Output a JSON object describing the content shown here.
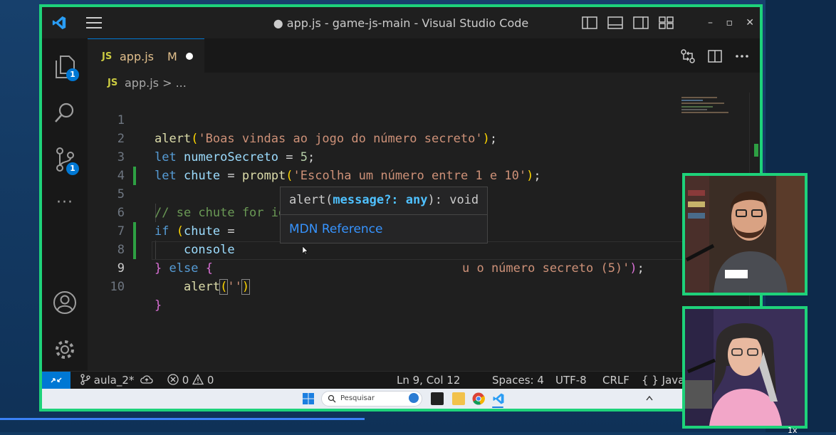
{
  "window": {
    "title": "● app.js - game-js-main - Visual Studio Code",
    "minimize": "–",
    "restore": "▫",
    "close": "✕"
  },
  "activity": {
    "explorer_badge": "1",
    "scm_badge": "1",
    "more": "···"
  },
  "tab": {
    "icon": "JS",
    "filename": "app.js",
    "status": "M"
  },
  "breadcrumb": {
    "icon": "JS",
    "text": "app.js > ..."
  },
  "editor": {
    "lines": [
      {
        "n": "1"
      },
      {
        "n": "2"
      },
      {
        "n": "3"
      },
      {
        "n": "4"
      },
      {
        "n": "5"
      },
      {
        "n": "6"
      },
      {
        "n": "7"
      },
      {
        "n": "8"
      },
      {
        "n": "9"
      },
      {
        "n": "10"
      }
    ],
    "code": {
      "l1_fn": "alert",
      "l1_str": "'Boas vindas ao jogo do número secreto'",
      "l2_kw": "let",
      "l2_var": "numeroSecreto",
      "l2_num": "5",
      "l3_kw": "let",
      "l3_var": "chute",
      "l3_fn": "prompt",
      "l3_str": "'Escolha um número entre 1 e 10'",
      "l5_comment": "// se chute for igual ao número secreto",
      "l6_kw": "if",
      "l6_var": "chute",
      "l7_obj": "console",
      "l7_str": "u o número secreto (5)'",
      "l8_kw": "else",
      "l9_fn": "alert",
      "l9_str": "''"
    }
  },
  "hover": {
    "fn": "alert(",
    "param": "message?:",
    "type": "any",
    "ret": "): void",
    "link": "MDN Reference"
  },
  "status": {
    "branch": "aula_2*",
    "errors": "0",
    "warnings": "0",
    "position": "Ln 9, Col 12",
    "spaces": "Spaces: 4",
    "encoding": "UTF-8",
    "eol": "CRLF",
    "language_icon": "{ }",
    "language": "JavaScript"
  },
  "taskbar": {
    "search_label": "Pesquisar"
  },
  "overlay": {
    "speed": "1x"
  },
  "colors": {
    "frame_border": "#1ed27a",
    "accent": "#0078d4"
  }
}
